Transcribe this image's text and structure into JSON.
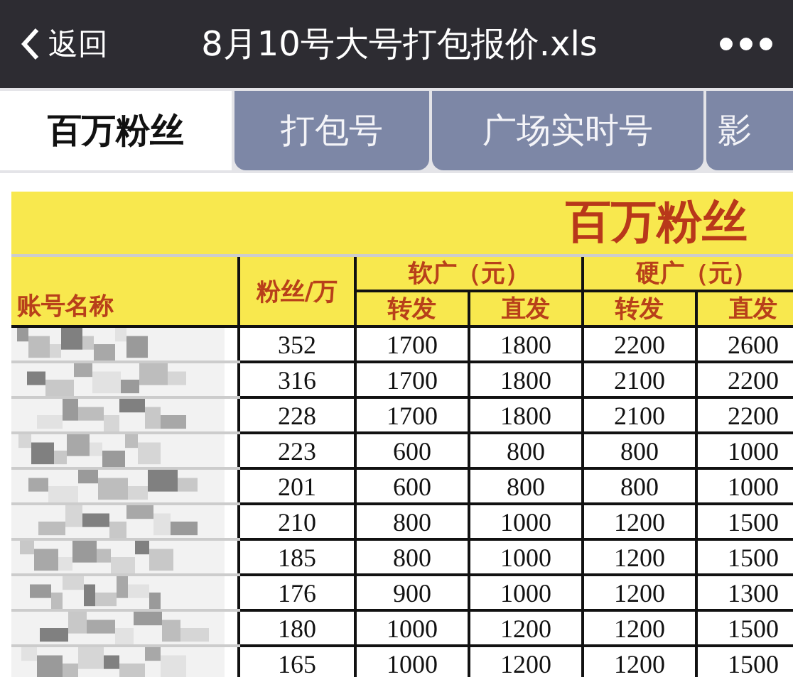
{
  "nav_bar": {
    "back_label": "返回",
    "title": "8月10号大号打包报价.xls"
  },
  "tabs": [
    {
      "label": "百万粉丝",
      "selected": true
    },
    {
      "label": "打包号",
      "selected": false
    },
    {
      "label": "广场实时号",
      "selected": false
    },
    {
      "label": "影",
      "selected": false
    }
  ],
  "sheet": {
    "title": "百万粉丝",
    "headers": {
      "account_name": "账号名称",
      "fans": "粉丝/万",
      "soft_ad": "软广（元）",
      "hard_ad": "硬广（元）",
      "sub": [
        "转发",
        "直发",
        "转发",
        "直发"
      ]
    },
    "rows": [
      {
        "cells": [
          "352",
          "1700",
          "1800",
          "2200",
          "2600"
        ]
      },
      {
        "cells": [
          "316",
          "1700",
          "1800",
          "2100",
          "2200"
        ]
      },
      {
        "cells": [
          "228",
          "1700",
          "1800",
          "2100",
          "2200"
        ]
      },
      {
        "cells": [
          "223",
          "600",
          "800",
          "800",
          "1000"
        ]
      },
      {
        "cells": [
          "201",
          "600",
          "800",
          "800",
          "1000"
        ]
      },
      {
        "cells": [
          "210",
          "800",
          "1000",
          "1200",
          "1500"
        ]
      },
      {
        "cells": [
          "185",
          "800",
          "1000",
          "1200",
          "1500"
        ]
      },
      {
        "cells": [
          "176",
          "900",
          "1000",
          "1200",
          "1300"
        ]
      },
      {
        "cells": [
          "180",
          "1000",
          "1200",
          "1200",
          "1500"
        ]
      },
      {
        "cells": [
          "165",
          "1000",
          "1200",
          "1200",
          "1500"
        ]
      }
    ]
  }
}
